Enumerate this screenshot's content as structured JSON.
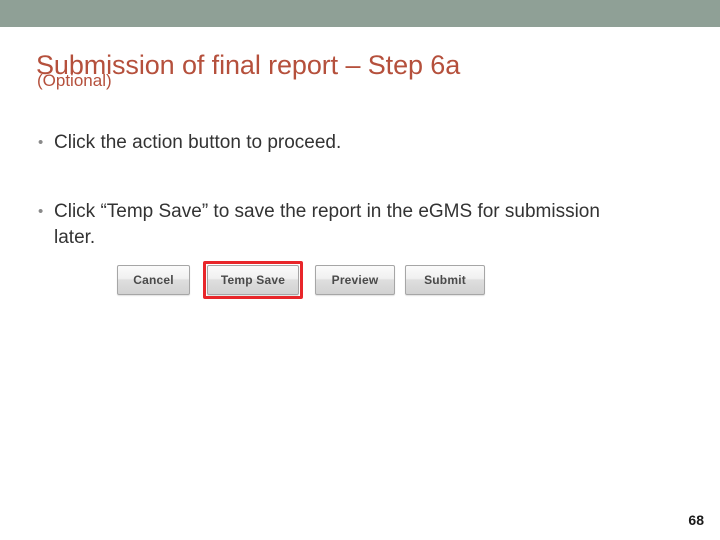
{
  "slide": {
    "top_band_color": "#8fa096",
    "background_color": "#ffffff",
    "title": "Submission of final report – Step 6a",
    "subtitle": "(Optional)",
    "title_color": "#b5503c",
    "body_text_color": "#333333",
    "page_number": "68"
  },
  "bullets": [
    {
      "marker": "•",
      "text": "Click the action button to proceed."
    },
    {
      "marker": "•",
      "text": "Click “Temp Save” to save the report in the eGMS for submission later."
    }
  ],
  "button_row": {
    "highlight_color": "#e8262a",
    "highlighted_button": "Temp Save",
    "buttons": [
      {
        "label": "Cancel"
      },
      {
        "label": "Temp Save"
      },
      {
        "label": "Preview"
      },
      {
        "label": "Submit"
      }
    ]
  }
}
